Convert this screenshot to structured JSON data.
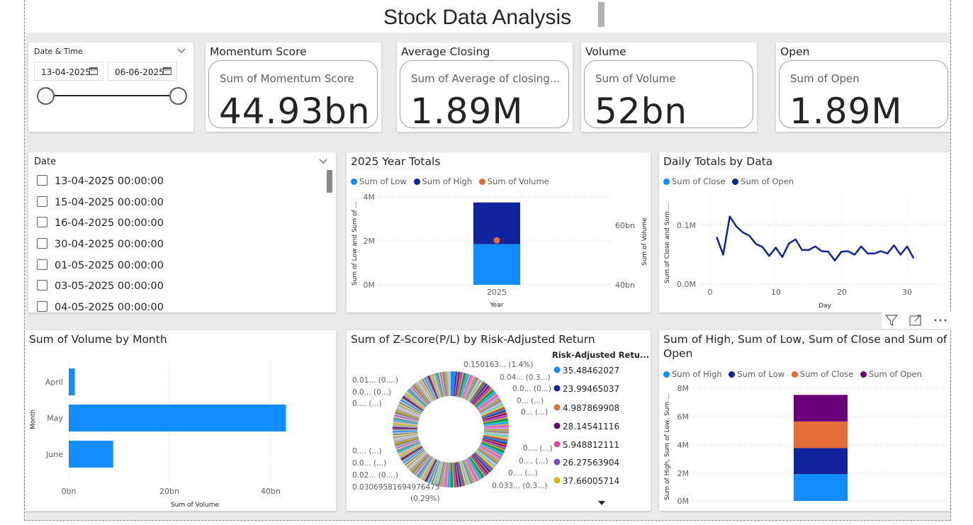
{
  "page_title": "Stock Data Analysis",
  "slicer_dt": {
    "title": "Date & Time",
    "start": "13-04-2025",
    "end": "06-06-2025"
  },
  "kpis": [
    {
      "title": "Momentum Score",
      "label": "Sum of Momentum Score",
      "value": "44.93bn"
    },
    {
      "title": "Average Closing",
      "label": "Sum of Average of closing...",
      "value": "1.89M"
    },
    {
      "title": "Volume",
      "label": "Sum of Volume",
      "value": "52bn"
    },
    {
      "title": "Open",
      "label": "Sum of Open",
      "value": "1.89M"
    }
  ],
  "date_slicer": {
    "title": "Date",
    "items": [
      "13-04-2025 00:00:00",
      "15-04-2025 00:00:00",
      "16-04-2025 00:00:00",
      "30-04-2025 00:00:00",
      "01-05-2025 00:00:00",
      "03-05-2025 00:00:00",
      "04-05-2025 00:00:00"
    ]
  },
  "year_totals": {
    "title": "2025 Year Totals",
    "legend": [
      "Sum of Low",
      "Sum of High",
      "Sum of Volume"
    ],
    "y_left_label": "Sum of Low and Sum of ...",
    "y_right_label": "Sum of Volume",
    "x_label": "Year",
    "left_ticks": [
      "4M",
      "2M",
      "0M"
    ],
    "right_ticks": [
      "60bn",
      "40bn"
    ],
    "category": "2025"
  },
  "daily_totals": {
    "title": "Daily Totals by Data",
    "legend": [
      "Sum of Close",
      "Sum of Open"
    ],
    "y_label": "Sum of Close and Sum ...",
    "x_label": "Day",
    "y_ticks": [
      "0.1M",
      "0.0M"
    ],
    "x_ticks": [
      "0",
      "10",
      "20",
      "30"
    ]
  },
  "volume_month": {
    "title": "Sum of Volume by Month",
    "y_label": "Month",
    "x_label": "Sum of Volume",
    "x_ticks": [
      "0bn",
      "20bn",
      "40bn"
    ]
  },
  "zscore": {
    "title": "Sum of Z-Score(P/L) by Risk-Adjusted Return",
    "legend_title": "Risk-Adjusted Retu...",
    "legend": [
      "35.48462027",
      "23.99465037",
      "4.987869908",
      "28.14541116",
      "5.948812111",
      "26.27563904",
      "37.66005714"
    ],
    "labels": [
      "0.150163... (1.4%)",
      "0.04... (0.3...)",
      "0.0... (0...)",
      "0... (...)",
      "0... (...)",
      "0.... (...)",
      "0.... (...)",
      "0.... (...)",
      "0.033... (0.3...)",
      "0.01... (0....)",
      "0.0... (0...)",
      "0.... (...)",
      "0.... (...)",
      "0.0... (...)",
      "0.02... (0....)",
      "0.03069581694976475",
      "(0.29%)"
    ]
  },
  "stacked": {
    "title_line1": "Sum of High, Sum of Low, Sum of Close and Sum of",
    "title_line2": "Open",
    "legend": [
      "Sum of High",
      "Sum of Low",
      "Sum of Close",
      "Sum of Open"
    ],
    "y_label": "Sum of High, Sum of Low, Sum ...",
    "y_ticks": [
      "8M",
      "6M",
      "4M",
      "2M",
      "0M"
    ]
  },
  "colors": {
    "blue": "#118dff",
    "navy": "#12239e",
    "orange": "#e66c37",
    "purple": "#6b007b",
    "pink": "#e044a7",
    "violet": "#744ec2",
    "gold": "#d9b300"
  },
  "chart_data": [
    {
      "type": "bar",
      "title": "2025 Year Totals",
      "categories": [
        "2025"
      ],
      "series": [
        {
          "name": "Sum of Low",
          "values": [
            1850000
          ]
        },
        {
          "name": "Sum of High",
          "values": [
            1900000
          ]
        },
        {
          "name": "Sum of Volume",
          "values": [
            52000000000
          ]
        }
      ],
      "ylim": [
        0,
        4000000
      ],
      "y2lim": [
        40000000000,
        70000000000
      ],
      "xlabel": "Year"
    },
    {
      "type": "line",
      "title": "Daily Totals by Data",
      "x": [
        1,
        2,
        3,
        4,
        5,
        6,
        7,
        8,
        9,
        10,
        11,
        12,
        13,
        14,
        15,
        16,
        17,
        18,
        19,
        20,
        21,
        22,
        23,
        24,
        25,
        26,
        27,
        28,
        29,
        30,
        31
      ],
      "series": [
        {
          "name": "Sum of Open",
          "values": [
            0.08,
            0.05,
            0.115,
            0.098,
            0.088,
            0.082,
            0.068,
            0.063,
            0.048,
            0.062,
            0.046,
            0.069,
            0.076,
            0.058,
            0.058,
            0.064,
            0.056,
            0.055,
            0.04,
            0.055,
            0.056,
            0.05,
            0.064,
            0.052,
            0.052,
            0.056,
            0.052,
            0.066,
            0.05,
            0.064,
            0.044
          ]
        }
      ],
      "ylim": [
        0.0,
        0.15
      ],
      "xlabel": "Day"
    },
    {
      "type": "bar",
      "title": "Sum of Volume by Month",
      "categories": [
        "April",
        "May",
        "June"
      ],
      "values": [
        1.2,
        43,
        8.8
      ],
      "xlabel": "Sum of Volume",
      "ylabel": "Month",
      "xlim": [
        0,
        45
      ]
    },
    {
      "type": "pie",
      "title": "Sum of Z-Score(P/L) by Risk-Adjusted Return",
      "categories": [
        "35.48462027",
        "23.99465037",
        "4.987869908",
        "28.14541116",
        "5.948812111",
        "26.27563904",
        "37.66005714"
      ]
    },
    {
      "type": "bar",
      "title": "Sum of High, Sum of Low, Sum of Close and Sum of Open",
      "categories": [
        ""
      ],
      "series": [
        {
          "name": "Sum of High",
          "values": [
            1900000
          ]
        },
        {
          "name": "Sum of Low",
          "values": [
            1850000
          ]
        },
        {
          "name": "Sum of Close",
          "values": [
            1890000
          ]
        },
        {
          "name": "Sum of Open",
          "values": [
            1890000
          ]
        }
      ],
      "ylim": [
        0,
        8000000
      ]
    }
  ]
}
